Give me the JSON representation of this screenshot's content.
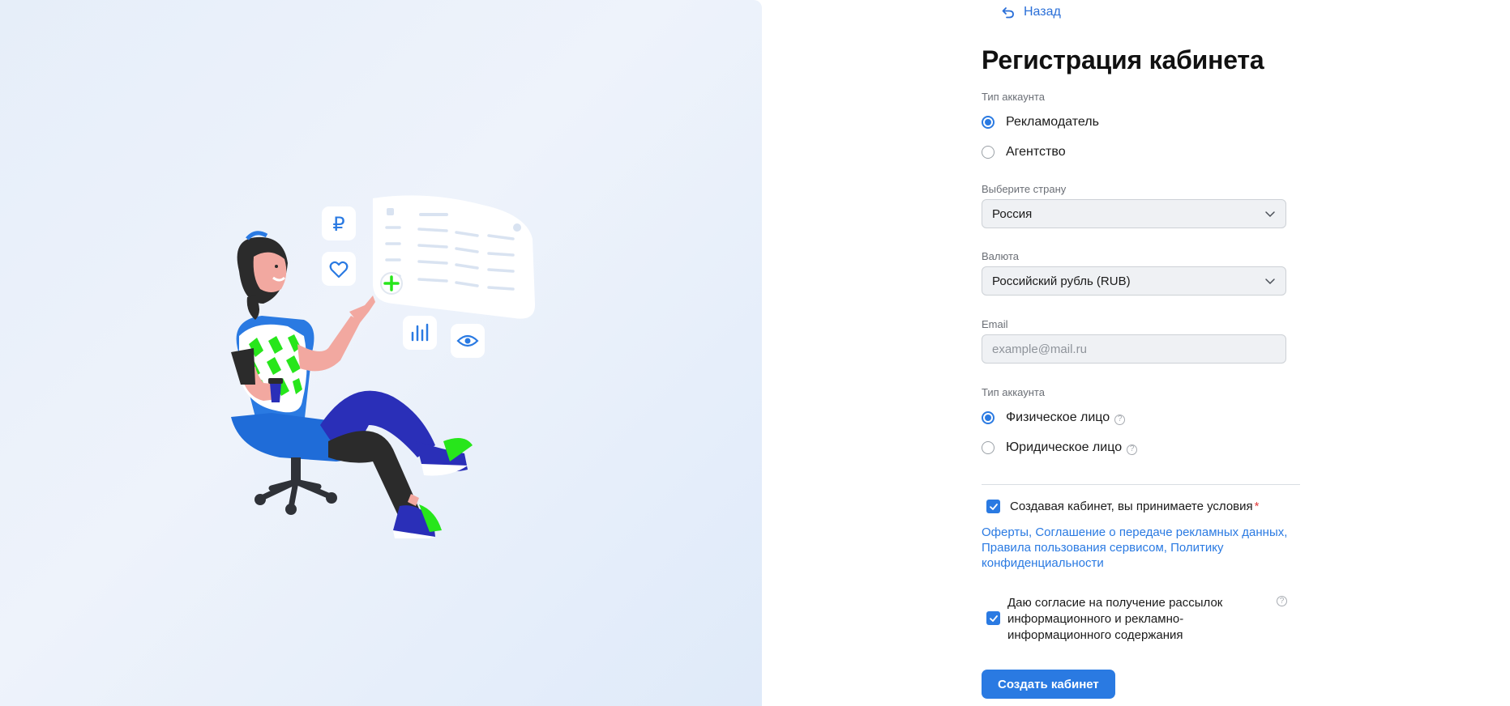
{
  "back": {
    "label": "Назад"
  },
  "title": "Регистрация кабинета",
  "account_type": {
    "label": "Тип аккаунта",
    "options": [
      {
        "label": "Рекламодатель",
        "selected": true
      },
      {
        "label": "Агентство",
        "selected": false
      }
    ]
  },
  "country": {
    "label": "Выберите страну",
    "value": "Россия"
  },
  "currency": {
    "label": "Валюта",
    "value": "Российский рубль (RUB)"
  },
  "email": {
    "label": "Email",
    "placeholder": "example@mail.ru",
    "value": ""
  },
  "person_type": {
    "label": "Тип аккаунта",
    "options": [
      {
        "label": "Физическое лицо",
        "selected": true,
        "help": "?"
      },
      {
        "label": "Юридическое лицо",
        "selected": false,
        "help": "?"
      }
    ]
  },
  "terms": {
    "checked": true,
    "label": "Создавая кабинет, вы принимаете условия",
    "required_mark": "*",
    "links_text": "Оферты, Соглашение о передаче рекламных данных, Правила пользования сервисом, Политику конфиденциальности"
  },
  "newsletter": {
    "checked": true,
    "label": "Даю согласие на получение рассылок информационного и рекламно-информационного содержания",
    "help": "?"
  },
  "submit": {
    "label": "Создать кабинет"
  },
  "illustration": {
    "ruble_symbol": "₽"
  },
  "colors": {
    "accent": "#2a7ae2",
    "link": "#2a6fd8",
    "required": "#e03a3a",
    "illustration_green": "#27e61b",
    "illustration_navy": "#2a2fb8"
  }
}
